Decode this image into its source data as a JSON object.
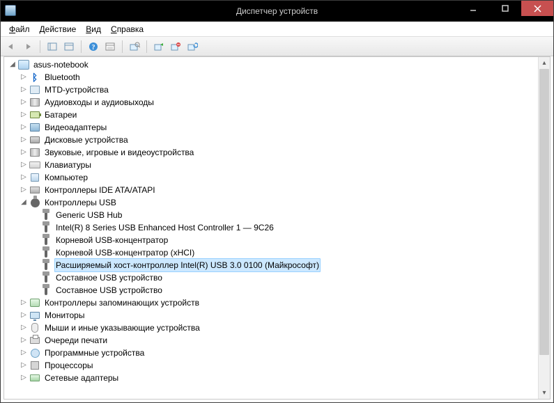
{
  "window": {
    "title": "Диспетчер устройств"
  },
  "menu": {
    "file": {
      "label": "Файл",
      "ul": "Ф",
      "rest": "айл"
    },
    "action": {
      "label": "Действие",
      "ul": "Д",
      "rest": "ействие"
    },
    "view": {
      "label": "Вид",
      "ul": "В",
      "rest": "ид"
    },
    "help": {
      "label": "Справка",
      "ul": "С",
      "rest": "правка"
    }
  },
  "tree": {
    "root": "asus-notebook",
    "bluetooth": "Bluetooth",
    "mtd": "MTD-устройства",
    "audio": "Аудиовходы и аудиовыходы",
    "battery": "Батареи",
    "video": "Видеоадаптеры",
    "disk": "Дисковые устройства",
    "sound": "Звуковые, игровые и видеоустройства",
    "keyboard": "Клавиатуры",
    "computer": "Компьютер",
    "ide": "Контроллеры IDE ATA/ATAPI",
    "usb": "Контроллеры USB",
    "usb_children": {
      "hub": "Generic USB Hub",
      "intel8": "Intel(R) 8 Series USB Enhanced Host Controller 1  — 9C26",
      "roothub": "Корневой USB-концентратор",
      "roothub_xhci": "Корневой USB-концентратор (xHCI)",
      "xhci_intel": "Расширяемый хост-контроллер Intel(R) USB 3.0 0100 (Майкрософт)",
      "composite1": "Составное USB устройство",
      "composite2": "Составное USB устройство"
    },
    "storage": "Контроллеры запоминающих устройств",
    "monitor": "Мониторы",
    "mouse": "Мыши и иные указывающие устройства",
    "print": "Очереди печати",
    "software": "Программные устройства",
    "cpu": "Процессоры",
    "net": "Сетевые адаптеры"
  }
}
